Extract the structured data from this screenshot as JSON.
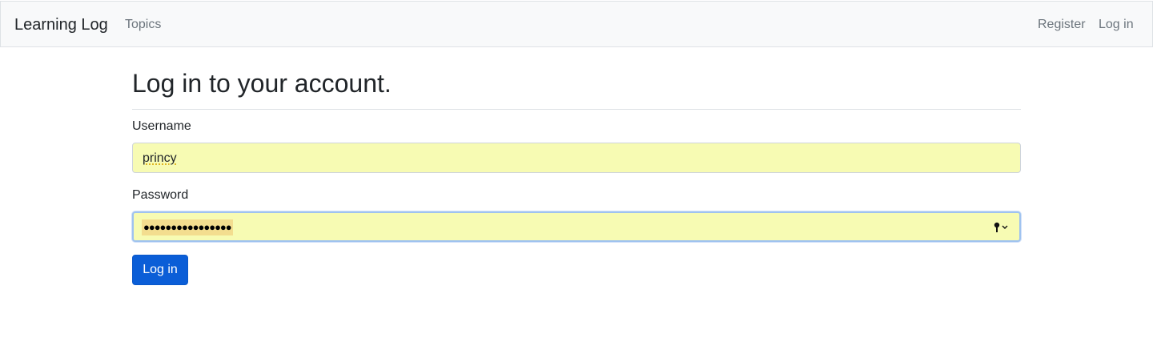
{
  "navbar": {
    "brand": "Learning Log",
    "links": {
      "topics": "Topics",
      "register": "Register",
      "login": "Log in"
    }
  },
  "main": {
    "title": "Log in to your account.",
    "form": {
      "username": {
        "label": "Username",
        "value": "princy"
      },
      "password": {
        "label": "Password",
        "masked_value": "●●●●●●●●●●●●●●●●"
      },
      "submit_label": "Log in"
    }
  },
  "colors": {
    "navbar_bg": "#f8f9fa",
    "autofill_bg": "#f7fbb3",
    "primary": "#0b5ed7",
    "link_muted": "#6c757d"
  },
  "icons": {
    "password_manager": "key-icon"
  }
}
